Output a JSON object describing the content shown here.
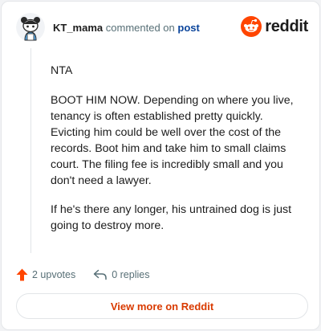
{
  "comment": {
    "username": "KT_mama",
    "commented_on_text": "commented on",
    "post_link_text": "post",
    "paragraphs": [
      "NTA",
      "BOOT HIM NOW. Depending on where you live, tenancy is often established pretty quickly. Evicting him could be well over the cost of the records. Boot him and take him to small claims court. The filing fee is incredibly small and you don't need a lawyer.",
      "If he's there any longer, his untrained dog is just going to destroy more."
    ]
  },
  "brand": {
    "wordmark": "reddit",
    "icon": "reddit-snoo-icon",
    "color": "#ff4500"
  },
  "actions": {
    "upvotes_label": "2 upvotes",
    "replies_label": "0 replies",
    "upvote_icon": "upvote-arrow-icon",
    "reply_icon": "reply-arrow-icon",
    "upvote_color": "#ff4500"
  },
  "footer": {
    "view_more_label": "View more on Reddit",
    "color": "#d93a00"
  }
}
